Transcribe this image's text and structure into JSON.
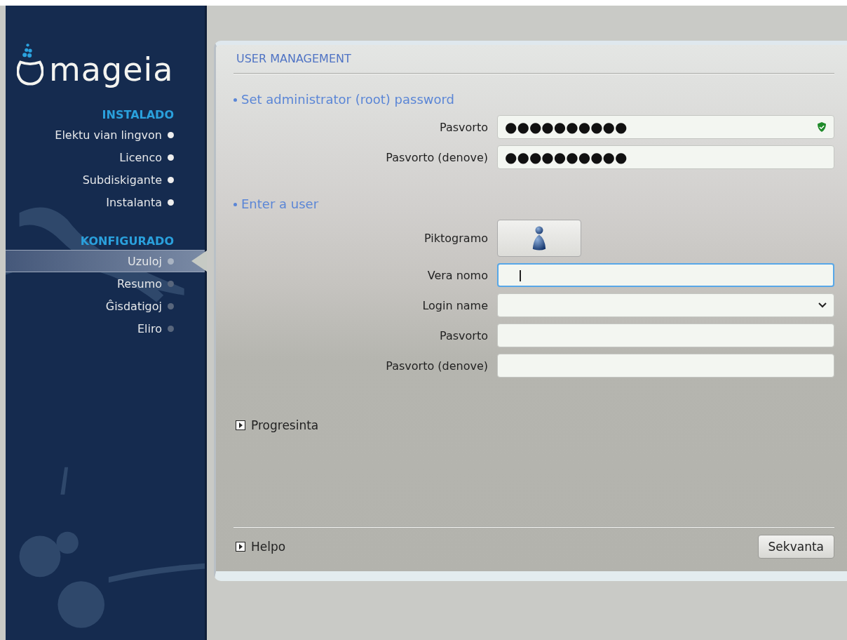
{
  "sidebar": {
    "logo": "mageia",
    "sections": [
      {
        "heading": "INSTALADO",
        "items": [
          {
            "label": "Elektu vian lingvon",
            "done": true,
            "selected": false
          },
          {
            "label": "Licenco",
            "done": true,
            "selected": false
          },
          {
            "label": "Subdiskigante",
            "done": true,
            "selected": false
          },
          {
            "label": "Instalanta",
            "done": true,
            "selected": false
          }
        ]
      },
      {
        "heading": "KONFIGURADO",
        "items": [
          {
            "label": "Uzuloj",
            "done": false,
            "selected": true
          },
          {
            "label": "Resumo",
            "done": false,
            "selected": false
          },
          {
            "label": "Ĝisdatigoj",
            "done": false,
            "selected": false
          },
          {
            "label": "Eliro",
            "done": false,
            "selected": false
          }
        ]
      }
    ]
  },
  "page": {
    "title": "USER MANAGEMENT",
    "sections": [
      {
        "heading": "Set administrator (root) password",
        "fields": [
          {
            "kind": "text",
            "label": "Pasvorto",
            "value": "●●●●●●●●●●",
            "strength_ok": true,
            "focused": false
          },
          {
            "kind": "text",
            "label": "Pasvorto (denove)",
            "value": "●●●●●●●●●●",
            "focused": false
          }
        ]
      },
      {
        "heading": "Enter a user",
        "fields": [
          {
            "kind": "icon",
            "label": "Piktogramo"
          },
          {
            "kind": "text",
            "label": "Vera nomo",
            "focused": true
          },
          {
            "kind": "combo",
            "label": "Login name",
            "focused": false
          },
          {
            "kind": "text",
            "label": "Pasvorto",
            "focused": false
          },
          {
            "kind": "text",
            "label": "Pasvorto (denove)",
            "focused": false
          }
        ]
      }
    ],
    "advanced": "Progresinta",
    "help": "Helpo",
    "next_button": "Sekvanta"
  }
}
